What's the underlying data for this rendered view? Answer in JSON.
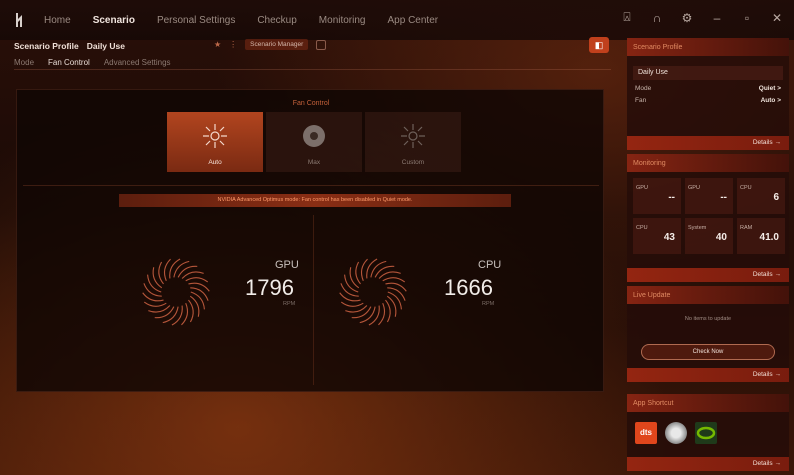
{
  "nav": {
    "tabs": [
      {
        "label": "Home",
        "active": false
      },
      {
        "label": "Scenario",
        "active": true
      },
      {
        "label": "Personal Settings",
        "active": false
      },
      {
        "label": "Checkup",
        "active": false
      },
      {
        "label": "Monitoring",
        "active": false
      },
      {
        "label": "App Center",
        "active": false
      }
    ],
    "window_controls": [
      "user-icon",
      "headset-icon",
      "gear-icon",
      "minimize-icon",
      "maximize-icon",
      "close-icon"
    ]
  },
  "scenario": {
    "profile_label": "Scenario Profile",
    "profile_value": "Daily Use",
    "manager_label": "Scenario Manager",
    "subtabs": [
      {
        "label": "Mode",
        "active": false
      },
      {
        "label": "Fan Control",
        "active": true
      },
      {
        "label": "Advanced Settings",
        "active": false
      }
    ]
  },
  "fan_control": {
    "title": "Fan Control",
    "modes": [
      {
        "label": "Auto",
        "active": true,
        "icon": "auto-fan-icon"
      },
      {
        "label": "Max",
        "active": false,
        "icon": "max-fan-icon"
      },
      {
        "label": "Custom",
        "active": false,
        "icon": "custom-fan-icon"
      }
    ],
    "warning": "NVIDIA Advanced Optimus mode: Fan control has been disabled in Quiet mode.",
    "fans": [
      {
        "name": "GPU",
        "rpm": "1796",
        "unit": "RPM"
      },
      {
        "name": "CPU",
        "rpm": "1666",
        "unit": "RPM"
      }
    ]
  },
  "sidebar": {
    "profile": {
      "header": "Scenario Profile",
      "selected": "Daily Use",
      "rows": [
        {
          "label": "Mode",
          "value": "Quiet >"
        },
        {
          "label": "Fan",
          "value": "Auto >"
        }
      ],
      "details": "Details →"
    },
    "monitoring": {
      "header": "Monitoring",
      "cells": [
        {
          "label": "GPU",
          "value": "--"
        },
        {
          "label": "GPU",
          "value": "--"
        },
        {
          "label": "CPU",
          "value": "6"
        },
        {
          "label": "CPU",
          "value": "43"
        },
        {
          "label": "System",
          "value": "40"
        },
        {
          "label": "RAM",
          "value": "41.0"
        }
      ],
      "details": "Details →"
    },
    "live_update": {
      "header": "Live Update",
      "text": "No items to update",
      "button": "Check Now",
      "details": "Details →"
    },
    "app_shortcut": {
      "header": "App Shortcut",
      "apps": [
        "dts-app-icon",
        "disc-app-icon",
        "nvidia-app-icon"
      ],
      "details": "Details →"
    }
  },
  "colors": {
    "accent": "#c0401c",
    "accent_text": "#e08a62",
    "warning_text": "#ff9a6a"
  }
}
